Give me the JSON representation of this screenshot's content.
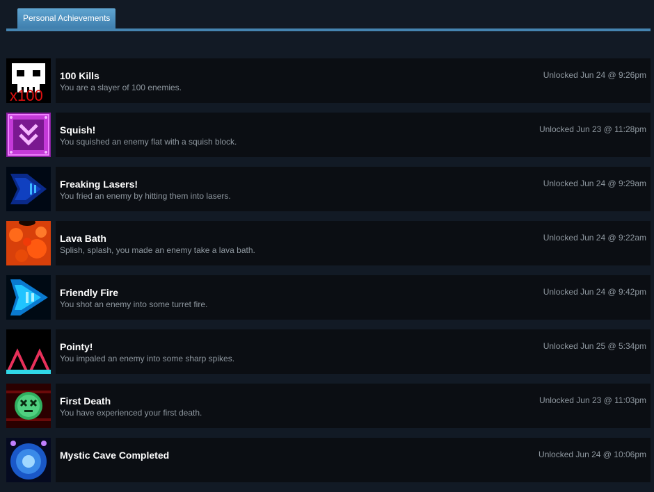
{
  "tabs": {
    "personal_label": "Personal Achievements"
  },
  "achievements": [
    {
      "title": "100 Kills",
      "description": "You are a slayer of 100 enemies.",
      "unlocked": "Unlocked Jun 24 @ 9:26pm",
      "icon": "skull-x100-icon",
      "icon_text": "x100"
    },
    {
      "title": "Squish!",
      "description": "You squished an enemy flat with a squish block.",
      "unlocked": "Unlocked Jun 23 @ 11:28pm",
      "icon": "squish-block-icon"
    },
    {
      "title": "Freaking Lasers!",
      "description": "You fried an enemy by hitting them into lasers.",
      "unlocked": "Unlocked Jun 24 @ 9:29am",
      "icon": "laser-icon"
    },
    {
      "title": "Lava Bath",
      "description": "Splish, splash, you made an enemy take a lava bath.",
      "unlocked": "Unlocked Jun 24 @ 9:22am",
      "icon": "lava-icon"
    },
    {
      "title": "Friendly Fire",
      "description": "You shot an enemy into some turret fire.",
      "unlocked": "Unlocked Jun 24 @ 9:42pm",
      "icon": "turret-fire-icon"
    },
    {
      "title": "Pointy!",
      "description": "You impaled an enemy into some sharp spikes.",
      "unlocked": "Unlocked Jun 25 @ 5:34pm",
      "icon": "spikes-icon"
    },
    {
      "title": "First Death",
      "description": "You have experienced your first death.",
      "unlocked": "Unlocked Jun 23 @ 11:03pm",
      "icon": "dead-face-icon"
    },
    {
      "title": "Mystic Cave Completed",
      "description": "",
      "unlocked": "Unlocked Jun 24 @ 10:06pm",
      "icon": "mystic-cave-icon"
    }
  ],
  "colors": {
    "background": "#121a25",
    "row_panel": "#0b0e13",
    "tab": "#4e92c2",
    "tab_line": "#4584b0",
    "title": "#ffffff",
    "muted": "#8f98a0"
  }
}
